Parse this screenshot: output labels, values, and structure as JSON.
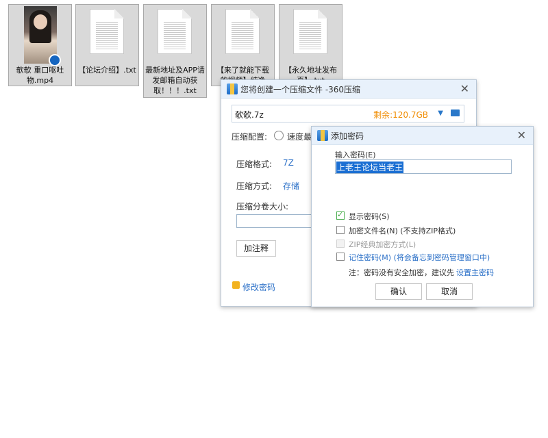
{
  "desktop": {
    "files": [
      {
        "name": "欹欹 重口呕吐物.mp4",
        "type": "video"
      },
      {
        "name": "【论坛介绍】.txt",
        "type": "text"
      },
      {
        "name": "最新地址及APP请发邮箱自动获取！！！.txt",
        "type": "text"
      },
      {
        "name": "【来了就能下载的视频】纯净",
        "type": "text"
      },
      {
        "name": "【永久地址发布页】.txt",
        "type": "text"
      }
    ]
  },
  "create_dialog": {
    "title": "您将创建一个压缩文件 -360压缩",
    "filename": "欹欹.7z",
    "remaining": "剩余:120.7GB",
    "config_label": "压缩配置:",
    "config_option": "速度最快",
    "format_label": "压缩格式:",
    "format_value": "7Z",
    "method_label": "压缩方式:",
    "method_value": "存储",
    "volume_label": "压缩分卷大小:",
    "comment_button": "加注释",
    "password_link": "修改密码"
  },
  "password_dialog": {
    "title": "添加密码",
    "input_label": "输入密码(E)",
    "password_value": "上老王论坛当老王",
    "show_password": "显示密码(S)",
    "encrypt_filenames": "加密文件名(N) (不支持ZIP格式)",
    "zip_classic": "ZIP经典加密方式(L)",
    "remember_password": "记住密码(M) (将会备忘到密码管理窗口中)",
    "note": "注：密码没有安全加密，建议先",
    "note_link": "设置主密码",
    "ok_button": "确认",
    "cancel_button": "取消"
  },
  "colors": {
    "accent": "#2a6fc7",
    "orange": "#f08c00",
    "selected_bg": "#d9d9d9"
  }
}
